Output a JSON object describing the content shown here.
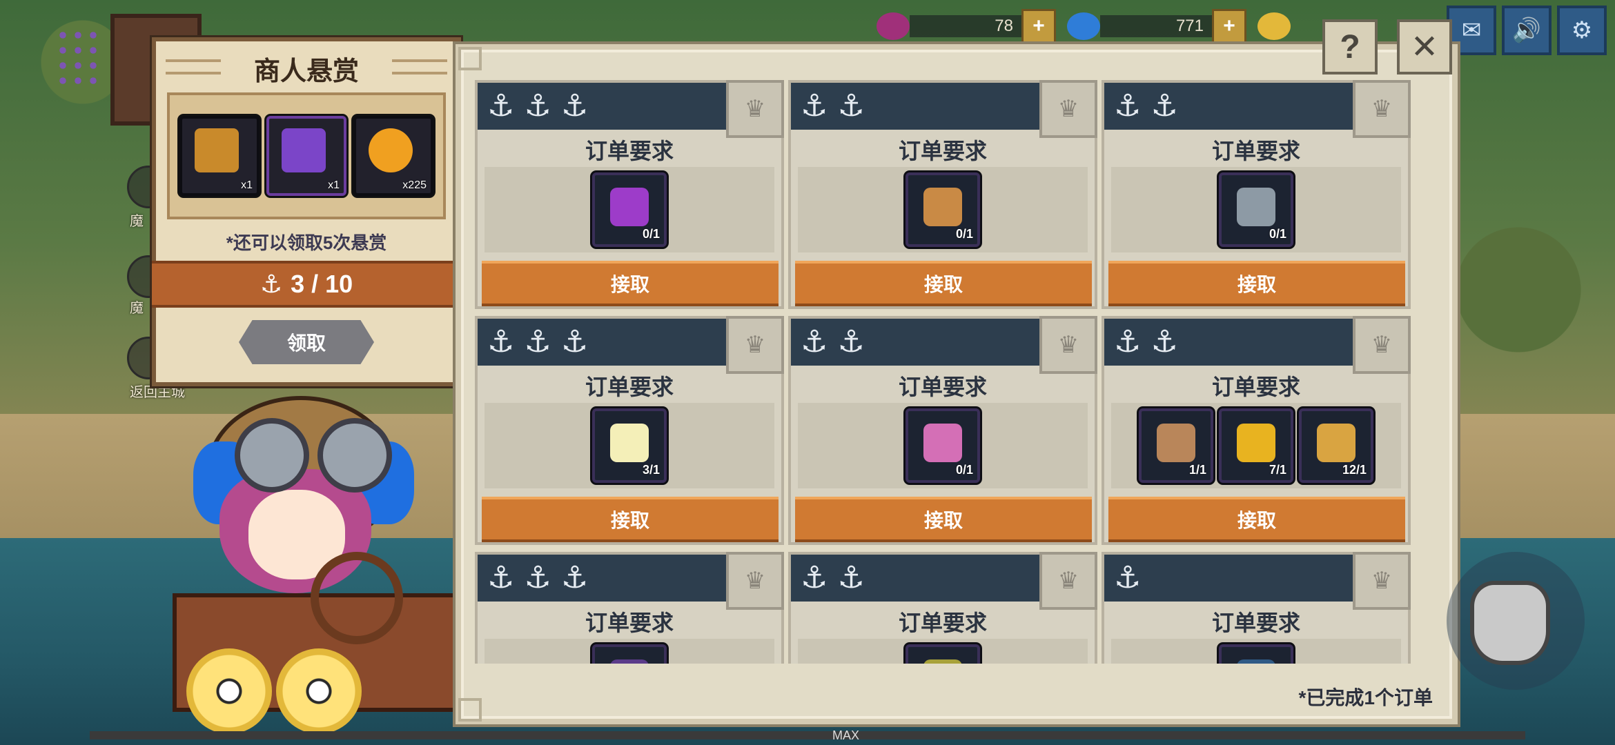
{
  "currency": [
    {
      "amount": "78",
      "color": "#a0307a"
    },
    {
      "amount": "771",
      "color": "#2f7dd8"
    },
    {
      "amount": "",
      "color": "#e3b83a"
    }
  ],
  "top_buttons": [
    "mail-icon",
    "speaker-icon",
    "gear-icon"
  ],
  "side_labels": [
    "魔",
    "魔",
    "返回主城"
  ],
  "bounty": {
    "title": "商人悬赏",
    "rewards": [
      {
        "icon": "mystery-chest-icon",
        "count": "x1",
        "color": "#c98a2b"
      },
      {
        "icon": "mystery-book-icon",
        "count": "x1",
        "color": "#7b45c8"
      },
      {
        "icon": "fire-orb-icon",
        "count": "x225",
        "color": "#f0a020"
      }
    ],
    "remaining_note": "*还可以领取5次悬赏",
    "progress": "3 / 10",
    "claim_label": "领取"
  },
  "orders": {
    "requirement_label": "订单要求",
    "accept_label": "接取",
    "cards": [
      {
        "anchors": 3,
        "items": [
          {
            "icon": "purple-potion-icon",
            "count": "0/1",
            "color": "#9d3cc9"
          }
        ]
      },
      {
        "anchors": 2,
        "items": [
          {
            "icon": "bread-icon",
            "count": "0/1",
            "color": "#c98a45"
          }
        ]
      },
      {
        "anchors": 2,
        "items": [
          {
            "icon": "fish-icon",
            "count": "0/1",
            "color": "#8d9aa5"
          }
        ]
      },
      {
        "anchors": 3,
        "items": [
          {
            "icon": "egg-icon",
            "count": "3/1",
            "color": "#f4efb8"
          }
        ]
      },
      {
        "anchors": 2,
        "items": [
          {
            "icon": "pink-potion-icon",
            "count": "0/1",
            "color": "#d46fb6"
          }
        ]
      },
      {
        "anchors": 2,
        "items": [
          {
            "icon": "potato-icon",
            "count": "1/1",
            "color": "#b9865a"
          },
          {
            "icon": "corn-icon",
            "count": "7/1",
            "color": "#e8b320"
          },
          {
            "icon": "wheat-icon",
            "count": "12/1",
            "color": "#d9a441"
          }
        ]
      },
      {
        "anchors": 3,
        "items": [
          {
            "icon": "unknown-item-icon",
            "count": "",
            "color": "#5b3c8a"
          }
        ]
      },
      {
        "anchors": 2,
        "items": [
          {
            "icon": "unknown-item-icon",
            "count": "",
            "color": "#a8a23a"
          }
        ]
      },
      {
        "anchors": 1,
        "items": [
          {
            "icon": "unknown-item-icon",
            "count": "",
            "color": "#2f5a86"
          }
        ]
      }
    ],
    "completed_note": "*已完成1个订单"
  },
  "footer": {
    "max_label": "MAX"
  }
}
